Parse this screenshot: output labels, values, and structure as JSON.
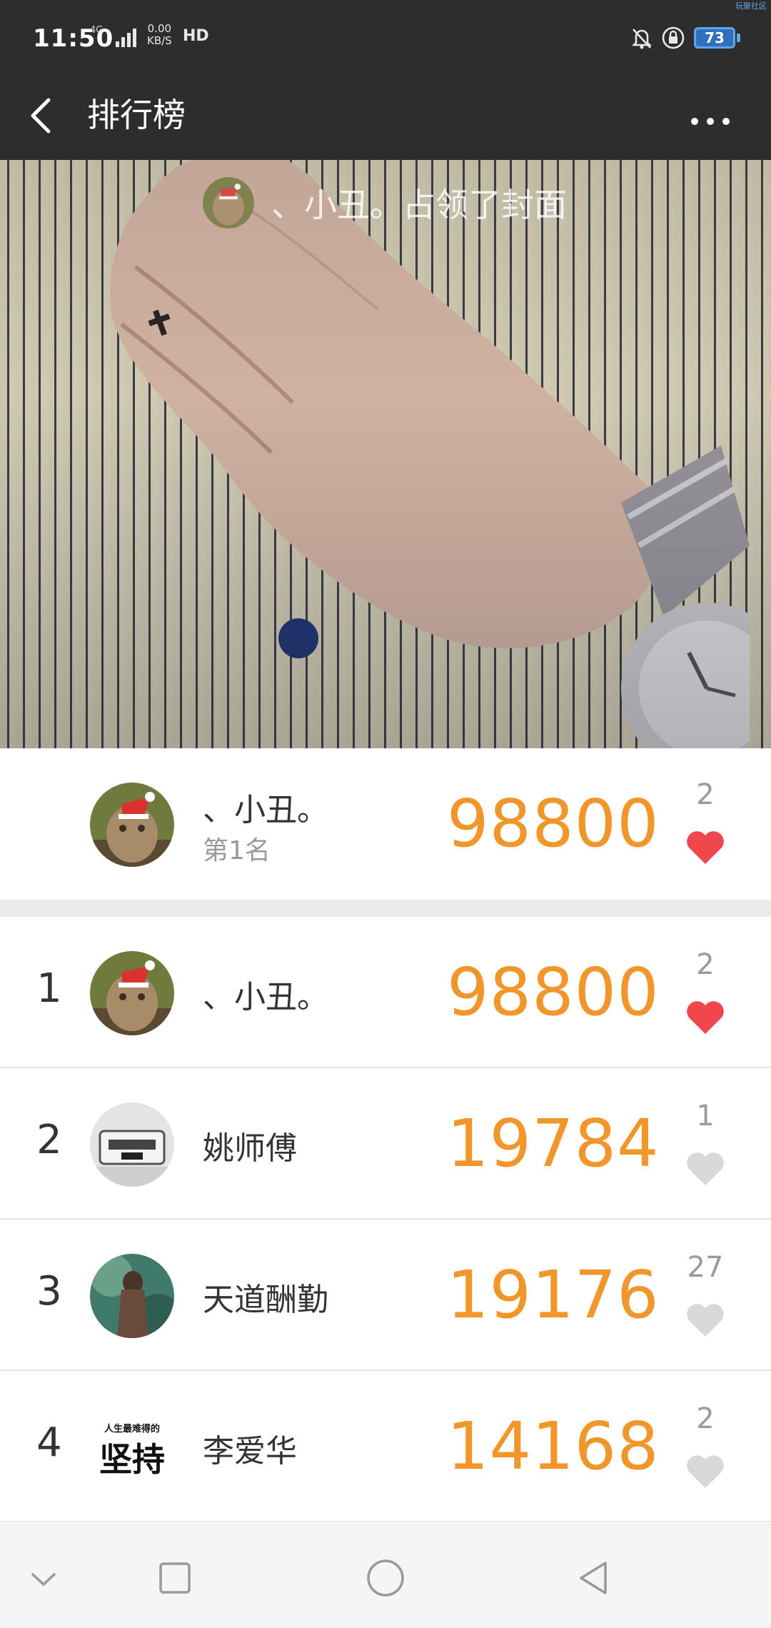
{
  "status_bar": {
    "time": "11:50",
    "network": "4G",
    "speed_value": "0.00",
    "speed_unit": "KB/S",
    "hd": "HD",
    "battery": "73",
    "corner_mark": "玩聚社区"
  },
  "title_bar": {
    "title": "排行榜",
    "back_icon": "chevron-left-icon",
    "more_icon": "more-horizontal-icon"
  },
  "banner": {
    "cover_text": "、小丑。占领了封面"
  },
  "champion": {
    "name": "、小丑。",
    "rank_text": "第1名",
    "score": "98800",
    "likes": "2",
    "liked": true
  },
  "rankings": [
    {
      "rank": "1",
      "name": "、小丑。",
      "score": "98800",
      "likes": "2",
      "liked": true
    },
    {
      "rank": "2",
      "name": "姚师傅",
      "score": "19784",
      "likes": "1",
      "liked": false
    },
    {
      "rank": "3",
      "name": "天道酬勤",
      "score": "19176",
      "likes": "27",
      "liked": false
    },
    {
      "rank": "4",
      "name": "李爱华",
      "score": "14168",
      "likes": "2",
      "liked": false
    }
  ],
  "avatar4_text": {
    "small": "人生最难得的",
    "large": "坚持"
  },
  "colors": {
    "score": "#f0962a",
    "liked_heart": "#f0474c",
    "unliked_heart": "#d8d8d8",
    "topbar": "#2d2d2d"
  },
  "nav_bar": {
    "icons": [
      "chevron-down-icon",
      "square-icon",
      "circle-icon",
      "triangle-back-icon"
    ]
  }
}
